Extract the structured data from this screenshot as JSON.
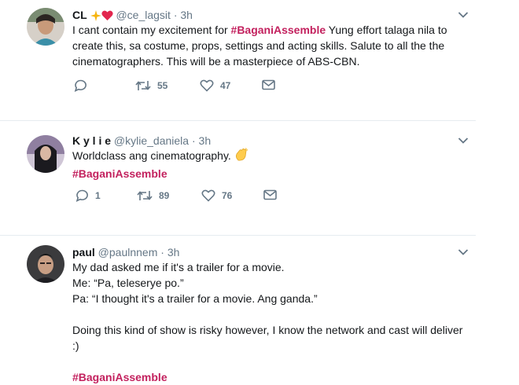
{
  "tweets": [
    {
      "name": "CL",
      "handle": "@ce_lagsit",
      "dot": "·",
      "time": "3h",
      "body_before": "I cant contain my excitement for ",
      "hashtag": "#BaganiAssemble",
      "body_after": " Yung effort talaga nila to create this, sa costume, props, settings and acting skills. Salute to all the the cinematographers. This will be a masterpiece of ABS-CBN.",
      "replies": "",
      "retweets": "55",
      "likes": "47"
    },
    {
      "name": "K y l i e",
      "handle": "@kylie_daniela",
      "dot": "·",
      "time": "3h",
      "line1": "Worldclass ang cinematography.",
      "hashtag": "#BaganiAssemble",
      "replies": "1",
      "retweets": "89",
      "likes": "76"
    },
    {
      "name": "paul",
      "handle": "@paulnnem",
      "dot": "·",
      "time": "3h",
      "lines": [
        "My dad asked me if it's a trailer for a movie.",
        "Me: “Pa, teleserye po.”",
        "Pa: “I thought it's a trailer for a movie. Ang ganda.”",
        "",
        "Doing this kind of show is risky however, I know the network and cast will deliver",
        ":)",
        "",
        "#BaganiAssemble"
      ]
    }
  ],
  "icons": {
    "reply": "reply-icon",
    "retweet": "retweet-icon",
    "like": "heart-icon",
    "dm": "envelope-icon",
    "more": "chevron-down-icon"
  },
  "colors": {
    "hashtag": "#c3215e",
    "muted": "#657786",
    "icon": "#657786"
  }
}
